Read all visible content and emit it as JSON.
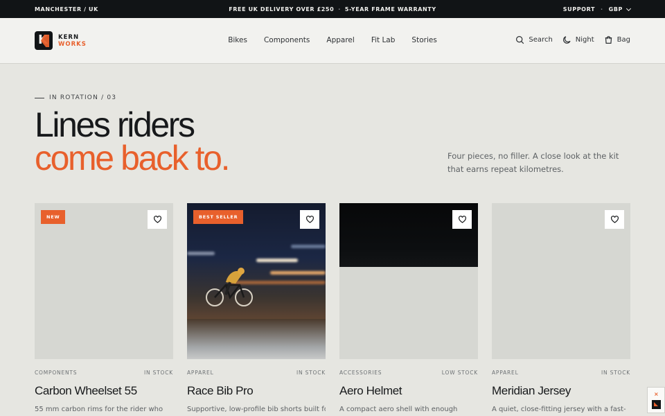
{
  "topbar": {
    "location": "MANCHESTER / UK",
    "promo_left": "FREE UK DELIVERY OVER £250",
    "promo_sep": "·",
    "promo_right": "5-YEAR FRAME WARRANTY",
    "support": "SUPPORT",
    "currency": "GBP"
  },
  "brand": {
    "line1": "KERN",
    "line2": "WORKS",
    "mark_letter": "K"
  },
  "nav": [
    "Bikes",
    "Components",
    "Apparel",
    "Fit Lab",
    "Stories"
  ],
  "actions": {
    "search": "Search",
    "night": "Night",
    "bag": "Bag"
  },
  "hero": {
    "eyebrow": "IN ROTATION / 03",
    "headline_1": "Lines riders",
    "headline_2": "come back to.",
    "lede": "Four pieces, no filler. A close look at the kit that earns repeat kilometres."
  },
  "products": [
    {
      "badge": "NEW",
      "category": "COMPONENTS",
      "stock": "IN STOCK",
      "title": "Carbon Wheelset 55",
      "desc": "55 mm carbon rims for the rider who"
    },
    {
      "badge": "BEST SELLER",
      "category": "APPAREL",
      "stock": "IN STOCK",
      "title": "Race Bib Pro",
      "desc": "Supportive, low-profile bib shorts built for"
    },
    {
      "badge": "",
      "category": "ACCESSORIES",
      "stock": "LOW STOCK",
      "title": "Aero Helmet",
      "desc": "A compact aero shell with enough"
    },
    {
      "badge": "",
      "category": "APPAREL",
      "stock": "IN STOCK",
      "title": "Meridian Jersey",
      "desc": "A quiet, close-fitting jersey with a fast-"
    }
  ],
  "colors": {
    "accent": "#e8602c",
    "ink": "#17191b",
    "page": "#e6e6e1",
    "topbar": "#111416"
  },
  "corner_widget": {
    "close": "×"
  }
}
